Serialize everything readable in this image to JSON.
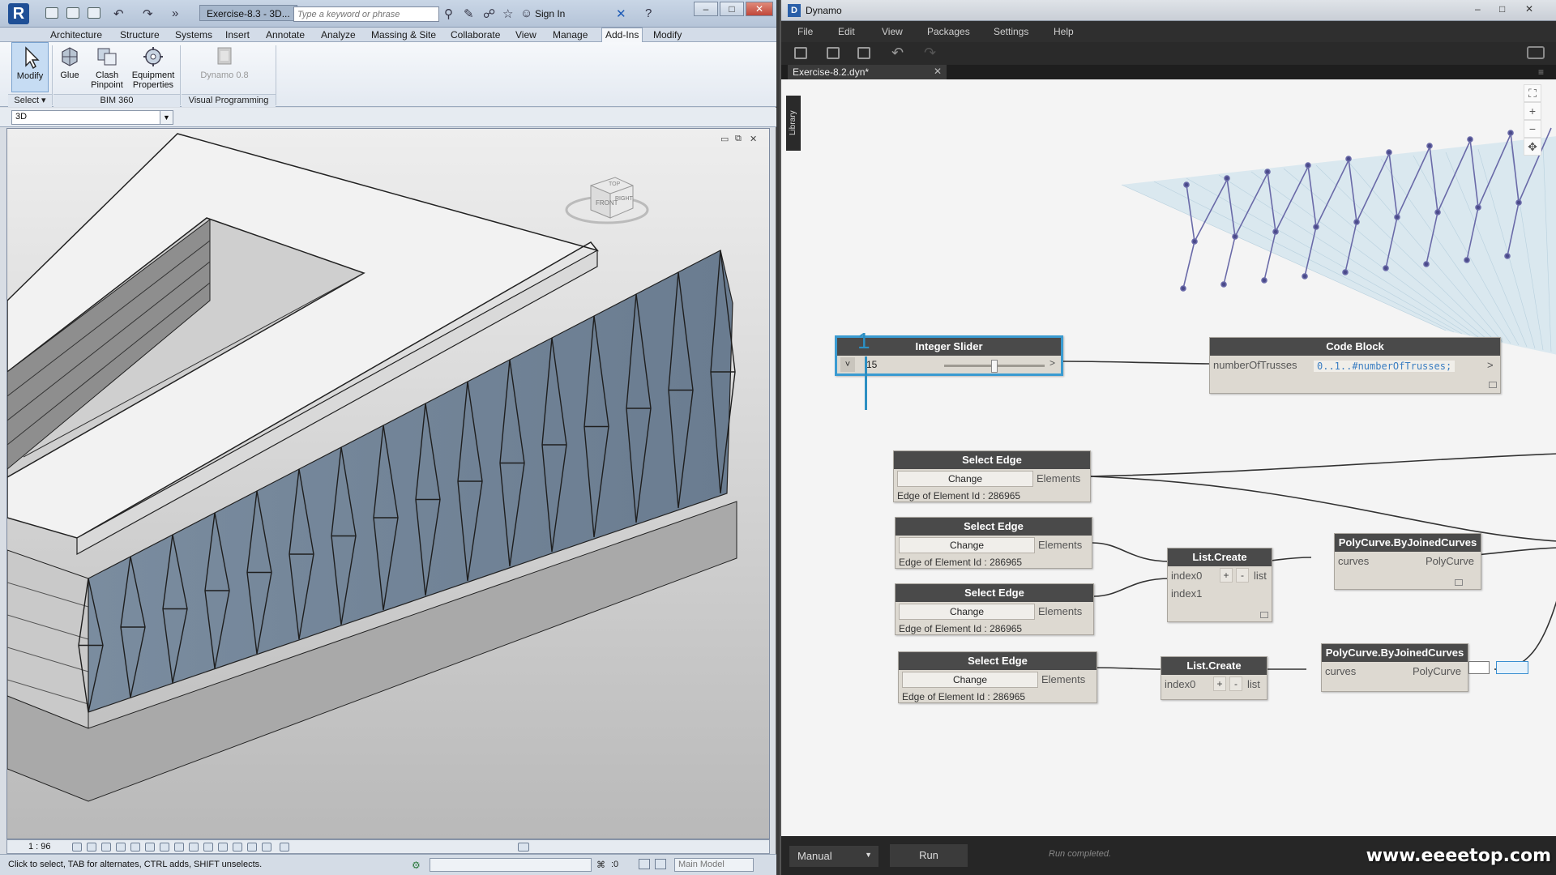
{
  "revit": {
    "window_title_tab": "Exercise-8.3 - 3D...",
    "search_placeholder": "Type a keyword or phrase",
    "sign_in": "Sign In",
    "ribbon_tabs": [
      "Architecture",
      "Structure",
      "Systems",
      "Insert",
      "Annotate",
      "Analyze",
      "Massing & Site",
      "Collaborate",
      "View",
      "Manage",
      "Add-Ins",
      "Modify"
    ],
    "active_ribbon_tab": "Add-Ins",
    "tools": {
      "modify": "Modify",
      "glue": "Glue",
      "clash_pinpoint_1": "Clash",
      "clash_pinpoint_2": "Pinpoint",
      "equipment_1": "Equipment",
      "equipment_2": "Properties",
      "dynamo": "Dynamo 0.8"
    },
    "panels": {
      "select": "Select ▾",
      "bim360": "BIM 360",
      "visual_programming": "Visual Programming"
    },
    "view_selector": "3D",
    "view_scale": "1 : 96",
    "status_text": "Click to select, TAB for alternates, CTRL adds, SHIFT unselects.",
    "status_zero": ":0",
    "main_model": "Main Model",
    "viewcube_front": "FRONT",
    "viewcube_right": "RIGHT",
    "viewcube_top": "TOP"
  },
  "dynamo": {
    "title": "Dynamo",
    "menu": [
      "File",
      "Edit",
      "View",
      "Packages",
      "Settings",
      "Help"
    ],
    "file_tab": "Exercise-8.2.dyn*",
    "library_tab": "Library",
    "callout": "1",
    "integer_slider": {
      "title": "Integer Slider",
      "value": "15",
      "value_fraction": 0.5,
      "expand_glyph": "˅",
      "right_glyph": ">"
    },
    "code_block": {
      "title": "Code Block",
      "var_label": "numberOfTrusses",
      "code": "0..1..#numberOfTrusses;",
      "output_glyph": ">"
    },
    "select_edge_nodes": [
      {
        "title": "Select Edge",
        "button": "Change",
        "output": "Elements",
        "info": "Edge of Element Id : 286965"
      },
      {
        "title": "Select Edge",
        "button": "Change",
        "output": "Elements",
        "info": "Edge of Element Id : 286965"
      },
      {
        "title": "Select Edge",
        "button": "Change",
        "output": "Elements",
        "info": "Edge of Element Id : 286965"
      },
      {
        "title": "Select Edge",
        "button": "Change",
        "output": "Elements",
        "info": "Edge of Element Id : 286965"
      }
    ],
    "list_create_nodes": [
      {
        "title": "List.Create",
        "inputs": [
          "index0",
          "index1"
        ],
        "output": "list"
      },
      {
        "title": "List.Create",
        "inputs": [
          "index0"
        ],
        "output": "list"
      }
    ],
    "polycurve_nodes": [
      {
        "title": "PolyCurve.ByJoinedCurves",
        "input": "curves",
        "output": "PolyCurve"
      },
      {
        "title": "PolyCurve.ByJoinedCurves",
        "input": "curves",
        "output": "PolyCurve"
      }
    ],
    "run_mode": "Manual",
    "run_button": "Run",
    "run_status": "Run completed.",
    "watermark": "www.eeeetop.com"
  }
}
